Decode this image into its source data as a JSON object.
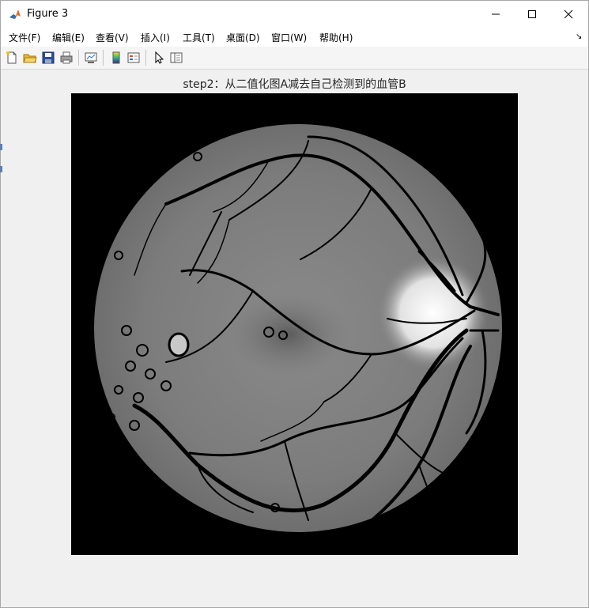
{
  "window": {
    "title": "Figure 3"
  },
  "menu": [
    {
      "label": "文件(F)"
    },
    {
      "label": "编辑(E)"
    },
    {
      "label": "查看(V)"
    },
    {
      "label": "插入(I)"
    },
    {
      "label": "工具(T)"
    },
    {
      "label": "桌面(D)"
    },
    {
      "label": "窗口(W)"
    },
    {
      "label": "帮助(H)"
    }
  ],
  "toolbar": [
    {
      "icon": "new-figure-icon"
    },
    {
      "icon": "open-file-icon"
    },
    {
      "icon": "save-icon"
    },
    {
      "icon": "print-icon"
    },
    {
      "icon": "link-plot-icon"
    },
    {
      "icon": "insert-colorbar-icon"
    },
    {
      "icon": "insert-legend-icon"
    },
    {
      "icon": "edit-plot-arrow-icon"
    },
    {
      "icon": "property-inspector-icon"
    }
  ],
  "figure": {
    "plot_title": "step2：从二值化图A减去自己检测到的血管B",
    "image_description_kind": "grayscale retinal fundus image with dark vessel network"
  },
  "colors": {
    "accent": "#0072bd",
    "figure_bg": "#f0f0f0",
    "axes_bg": "#000000"
  }
}
